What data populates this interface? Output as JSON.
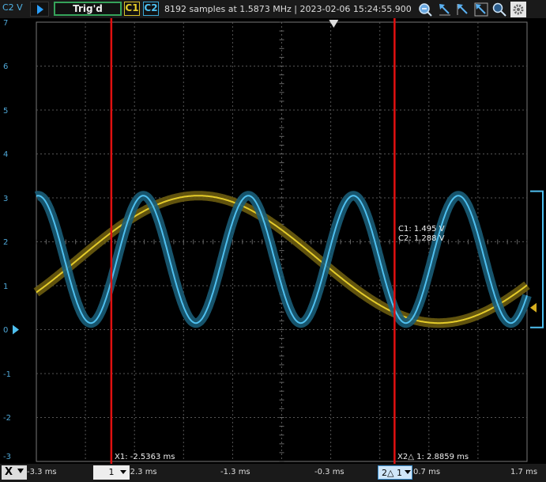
{
  "header": {
    "channel_unit": "C2 V",
    "trigger_status": "Trig'd",
    "channel1_label": "C1",
    "channel2_label": "C2",
    "acquisition_info": "8192 samples at 1.5873 MHz | 2023-02-06 15:24:55.900",
    "tools": [
      "zoom-fit-icon",
      "cursor-arrow-icon",
      "cursor-arrow-icon",
      "cursor-arrow-icon",
      "zoom-icon",
      "settings-icon"
    ]
  },
  "y_axis": {
    "labels": [
      "7",
      "6",
      "5",
      "4",
      "3",
      "2",
      "1",
      "0",
      "-1",
      "-2",
      "-3"
    ],
    "unit": "V"
  },
  "x_axis": {
    "labels": [
      "-3.3 ms",
      "-2.3 ms",
      "-1.3 ms",
      "-0.3 ms",
      "0.7 ms",
      "1.7 ms"
    ]
  },
  "bottom_bar": {
    "x_button": "X",
    "selector1": "1",
    "selector2": "2△ 1"
  },
  "cursors": {
    "x1_label": "X1: -2.5363 ms",
    "x2_label": "X2△ 1: 2.8859 ms",
    "readout_c1": "C1: 1.495 V",
    "readout_c2": "C2: 1.288 V"
  },
  "colors": {
    "channel1": "#e5cc2a",
    "channel2": "#4fc0f0",
    "cursor": "#e01010",
    "grid": "#555555"
  },
  "chart_data": {
    "type": "line",
    "x_unit": "ms",
    "y_unit": "V",
    "xlim": [
      -3.3,
      1.7
    ],
    "ylim": [
      -3,
      7
    ],
    "grid": true,
    "series": [
      {
        "name": "C1",
        "form": "sine",
        "offset": 1.6,
        "amplitude": 1.45,
        "period_ms": 4.9,
        "peak_at_ms": -1.65
      },
      {
        "name": "C2",
        "form": "sine",
        "offset": 1.6,
        "amplitude": 1.45,
        "period_ms": 1.07,
        "peak_at_ms": -3.28
      }
    ],
    "cursor_x1_ms": -2.5363,
    "cursor_x2_ms": 0.35,
    "trigger_x_ms": -0.27
  }
}
